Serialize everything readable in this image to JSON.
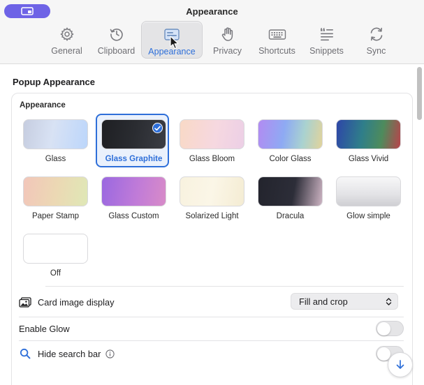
{
  "window": {
    "title": "Appearance",
    "accent_color": "#2e6fd9",
    "pill_color": "#6e63e6",
    "pill_icon": "display-icon"
  },
  "tabs": [
    {
      "label": "General",
      "icon": "gear-icon",
      "active": false
    },
    {
      "label": "Clipboard",
      "icon": "clock-history-icon",
      "active": false
    },
    {
      "label": "Appearance",
      "icon": "window-display-icon",
      "active": true
    },
    {
      "label": "Privacy",
      "icon": "hand-icon",
      "active": false
    },
    {
      "label": "Shortcuts",
      "icon": "keyboard-icon",
      "active": false
    },
    {
      "label": "Snippets",
      "icon": "quote-lines-icon",
      "active": false
    },
    {
      "label": "Sync",
      "icon": "sync-arrows-icon",
      "active": false
    }
  ],
  "section": {
    "title": "Popup Appearance",
    "group_label": "Appearance"
  },
  "themes": [
    {
      "name": "Glass",
      "selected": false,
      "gradient": "linear-gradient(100deg,#c6cde0 0%,#d8e2f4 45%,#bcd6fb 100%)"
    },
    {
      "name": "Glass Graphite",
      "selected": true,
      "gradient": "linear-gradient(100deg,#1e1f23 0%,#2a2c31 50%,#3b3d44 100%)"
    },
    {
      "name": "Glass Bloom",
      "selected": false,
      "gradient": "linear-gradient(100deg,#f9d9c6 0%,#f6d8e0 55%,#eccfe6 100%)"
    },
    {
      "name": "Color Glass",
      "selected": false,
      "gradient": "linear-gradient(100deg,#b28bf2 0%,#8eaaf3 40%,#a9d2d0 70%,#e2d39b 100%)"
    },
    {
      "name": "Glass Vivid",
      "selected": false,
      "gradient": "linear-gradient(100deg,#2e46a8 0%,#2f7e8a 40%,#4e8b5c 70%,#b9434b 100%)"
    },
    {
      "name": "Paper Stamp",
      "selected": false,
      "gradient": "linear-gradient(100deg,#f2c6ba 0%,#ecd8b4 50%,#dfe8b6 100%)"
    },
    {
      "name": "Glass Custom",
      "selected": false,
      "gradient": "linear-gradient(100deg,#9a68e0 0%,#c07bd8 55%,#d88bc8 100%)"
    },
    {
      "name": "Solarized Light",
      "selected": false,
      "gradient": "linear-gradient(100deg,#f8f2df 0%,#fbf6e7 50%,#f4ecd3 100%)"
    },
    {
      "name": "Dracula",
      "selected": false,
      "gradient": "linear-gradient(100deg,#23242d 0%,#2c2d38 55%,#cdb4c3 100%)"
    },
    {
      "name": "Glow simple",
      "selected": false,
      "gradient": "linear-gradient(180deg,#f7f7f8 0%,#e3e3e6 60%,#cfcfd3 100%)"
    },
    {
      "name": "Off",
      "selected": false,
      "gradient": "linear-gradient(180deg,#ffffff 0%,#ffffff 100%)"
    }
  ],
  "settings": {
    "card_image_label": "Card image display",
    "card_image_icon": "photo-icon",
    "card_image_value": "Fill and crop",
    "enable_glow_label": "Enable Glow",
    "enable_glow_on": false,
    "hide_search_label": "Hide search bar",
    "hide_search_icon": "search-icon",
    "hide_search_info_icon": "info-icon",
    "hide_search_on": false
  }
}
